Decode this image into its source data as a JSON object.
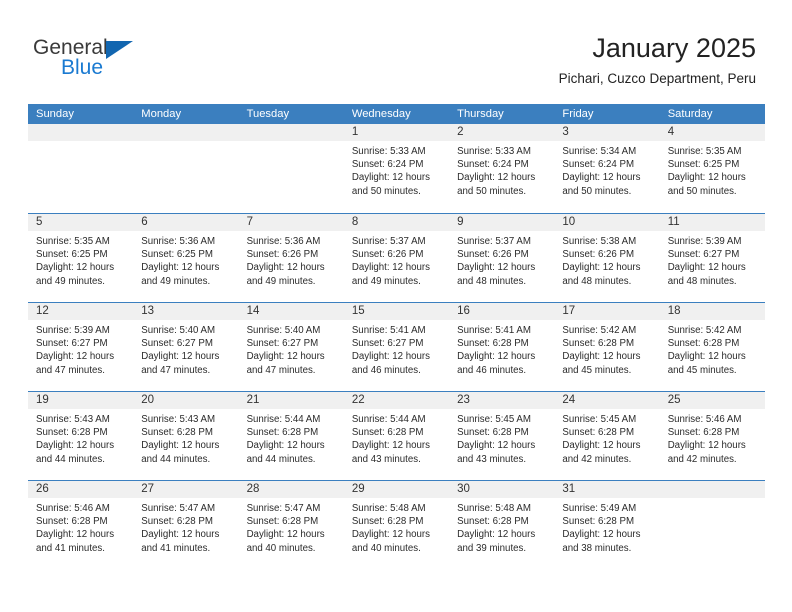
{
  "brand": {
    "name_part1": "General",
    "name_part2": "Blue",
    "triangle_color": "#1266b0",
    "blue_color": "#1a7ad1"
  },
  "header": {
    "title": "January 2025",
    "subtitle": "Pichari, Cuzco Department, Peru"
  },
  "theme": {
    "header_bar": "#3b7fbf",
    "daynum_band": "#f0f0f0",
    "text": "#2b2b2b"
  },
  "weekdays": [
    "Sunday",
    "Monday",
    "Tuesday",
    "Wednesday",
    "Thursday",
    "Friday",
    "Saturday"
  ],
  "weeks": [
    [
      {
        "day": "",
        "sunrise": "",
        "sunset": "",
        "daylight_line1": "",
        "daylight_line2": "",
        "empty": true
      },
      {
        "day": "",
        "sunrise": "",
        "sunset": "",
        "daylight_line1": "",
        "daylight_line2": "",
        "empty": true
      },
      {
        "day": "",
        "sunrise": "",
        "sunset": "",
        "daylight_line1": "",
        "daylight_line2": "",
        "empty": true
      },
      {
        "day": "1",
        "sunrise": "Sunrise: 5:33 AM",
        "sunset": "Sunset: 6:24 PM",
        "daylight_line1": "Daylight: 12 hours",
        "daylight_line2": "and 50 minutes."
      },
      {
        "day": "2",
        "sunrise": "Sunrise: 5:33 AM",
        "sunset": "Sunset: 6:24 PM",
        "daylight_line1": "Daylight: 12 hours",
        "daylight_line2": "and 50 minutes."
      },
      {
        "day": "3",
        "sunrise": "Sunrise: 5:34 AM",
        "sunset": "Sunset: 6:24 PM",
        "daylight_line1": "Daylight: 12 hours",
        "daylight_line2": "and 50 minutes."
      },
      {
        "day": "4",
        "sunrise": "Sunrise: 5:35 AM",
        "sunset": "Sunset: 6:25 PM",
        "daylight_line1": "Daylight: 12 hours",
        "daylight_line2": "and 50 minutes."
      }
    ],
    [
      {
        "day": "5",
        "sunrise": "Sunrise: 5:35 AM",
        "sunset": "Sunset: 6:25 PM",
        "daylight_line1": "Daylight: 12 hours",
        "daylight_line2": "and 49 minutes."
      },
      {
        "day": "6",
        "sunrise": "Sunrise: 5:36 AM",
        "sunset": "Sunset: 6:25 PM",
        "daylight_line1": "Daylight: 12 hours",
        "daylight_line2": "and 49 minutes."
      },
      {
        "day": "7",
        "sunrise": "Sunrise: 5:36 AM",
        "sunset": "Sunset: 6:26 PM",
        "daylight_line1": "Daylight: 12 hours",
        "daylight_line2": "and 49 minutes."
      },
      {
        "day": "8",
        "sunrise": "Sunrise: 5:37 AM",
        "sunset": "Sunset: 6:26 PM",
        "daylight_line1": "Daylight: 12 hours",
        "daylight_line2": "and 49 minutes."
      },
      {
        "day": "9",
        "sunrise": "Sunrise: 5:37 AM",
        "sunset": "Sunset: 6:26 PM",
        "daylight_line1": "Daylight: 12 hours",
        "daylight_line2": "and 48 minutes."
      },
      {
        "day": "10",
        "sunrise": "Sunrise: 5:38 AM",
        "sunset": "Sunset: 6:26 PM",
        "daylight_line1": "Daylight: 12 hours",
        "daylight_line2": "and 48 minutes."
      },
      {
        "day": "11",
        "sunrise": "Sunrise: 5:39 AM",
        "sunset": "Sunset: 6:27 PM",
        "daylight_line1": "Daylight: 12 hours",
        "daylight_line2": "and 48 minutes."
      }
    ],
    [
      {
        "day": "12",
        "sunrise": "Sunrise: 5:39 AM",
        "sunset": "Sunset: 6:27 PM",
        "daylight_line1": "Daylight: 12 hours",
        "daylight_line2": "and 47 minutes."
      },
      {
        "day": "13",
        "sunrise": "Sunrise: 5:40 AM",
        "sunset": "Sunset: 6:27 PM",
        "daylight_line1": "Daylight: 12 hours",
        "daylight_line2": "and 47 minutes."
      },
      {
        "day": "14",
        "sunrise": "Sunrise: 5:40 AM",
        "sunset": "Sunset: 6:27 PM",
        "daylight_line1": "Daylight: 12 hours",
        "daylight_line2": "and 47 minutes."
      },
      {
        "day": "15",
        "sunrise": "Sunrise: 5:41 AM",
        "sunset": "Sunset: 6:27 PM",
        "daylight_line1": "Daylight: 12 hours",
        "daylight_line2": "and 46 minutes."
      },
      {
        "day": "16",
        "sunrise": "Sunrise: 5:41 AM",
        "sunset": "Sunset: 6:28 PM",
        "daylight_line1": "Daylight: 12 hours",
        "daylight_line2": "and 46 minutes."
      },
      {
        "day": "17",
        "sunrise": "Sunrise: 5:42 AM",
        "sunset": "Sunset: 6:28 PM",
        "daylight_line1": "Daylight: 12 hours",
        "daylight_line2": "and 45 minutes."
      },
      {
        "day": "18",
        "sunrise": "Sunrise: 5:42 AM",
        "sunset": "Sunset: 6:28 PM",
        "daylight_line1": "Daylight: 12 hours",
        "daylight_line2": "and 45 minutes."
      }
    ],
    [
      {
        "day": "19",
        "sunrise": "Sunrise: 5:43 AM",
        "sunset": "Sunset: 6:28 PM",
        "daylight_line1": "Daylight: 12 hours",
        "daylight_line2": "and 44 minutes."
      },
      {
        "day": "20",
        "sunrise": "Sunrise: 5:43 AM",
        "sunset": "Sunset: 6:28 PM",
        "daylight_line1": "Daylight: 12 hours",
        "daylight_line2": "and 44 minutes."
      },
      {
        "day": "21",
        "sunrise": "Sunrise: 5:44 AM",
        "sunset": "Sunset: 6:28 PM",
        "daylight_line1": "Daylight: 12 hours",
        "daylight_line2": "and 44 minutes."
      },
      {
        "day": "22",
        "sunrise": "Sunrise: 5:44 AM",
        "sunset": "Sunset: 6:28 PM",
        "daylight_line1": "Daylight: 12 hours",
        "daylight_line2": "and 43 minutes."
      },
      {
        "day": "23",
        "sunrise": "Sunrise: 5:45 AM",
        "sunset": "Sunset: 6:28 PM",
        "daylight_line1": "Daylight: 12 hours",
        "daylight_line2": "and 43 minutes."
      },
      {
        "day": "24",
        "sunrise": "Sunrise: 5:45 AM",
        "sunset": "Sunset: 6:28 PM",
        "daylight_line1": "Daylight: 12 hours",
        "daylight_line2": "and 42 minutes."
      },
      {
        "day": "25",
        "sunrise": "Sunrise: 5:46 AM",
        "sunset": "Sunset: 6:28 PM",
        "daylight_line1": "Daylight: 12 hours",
        "daylight_line2": "and 42 minutes."
      }
    ],
    [
      {
        "day": "26",
        "sunrise": "Sunrise: 5:46 AM",
        "sunset": "Sunset: 6:28 PM",
        "daylight_line1": "Daylight: 12 hours",
        "daylight_line2": "and 41 minutes."
      },
      {
        "day": "27",
        "sunrise": "Sunrise: 5:47 AM",
        "sunset": "Sunset: 6:28 PM",
        "daylight_line1": "Daylight: 12 hours",
        "daylight_line2": "and 41 minutes."
      },
      {
        "day": "28",
        "sunrise": "Sunrise: 5:47 AM",
        "sunset": "Sunset: 6:28 PM",
        "daylight_line1": "Daylight: 12 hours",
        "daylight_line2": "and 40 minutes."
      },
      {
        "day": "29",
        "sunrise": "Sunrise: 5:48 AM",
        "sunset": "Sunset: 6:28 PM",
        "daylight_line1": "Daylight: 12 hours",
        "daylight_line2": "and 40 minutes."
      },
      {
        "day": "30",
        "sunrise": "Sunrise: 5:48 AM",
        "sunset": "Sunset: 6:28 PM",
        "daylight_line1": "Daylight: 12 hours",
        "daylight_line2": "and 39 minutes."
      },
      {
        "day": "31",
        "sunrise": "Sunrise: 5:49 AM",
        "sunset": "Sunset: 6:28 PM",
        "daylight_line1": "Daylight: 12 hours",
        "daylight_line2": "and 38 minutes."
      },
      {
        "day": "",
        "sunrise": "",
        "sunset": "",
        "daylight_line1": "",
        "daylight_line2": "",
        "empty": true
      }
    ]
  ]
}
